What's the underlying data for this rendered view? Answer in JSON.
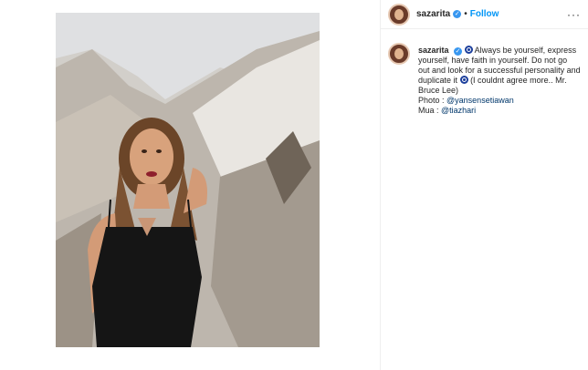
{
  "header": {
    "username": "sazarita",
    "separator": "•",
    "follow_label": "Follow",
    "more_label": "···"
  },
  "caption": {
    "username": "sazarita",
    "text_1": "Always be yourself, express yourself, have faith in yourself. Do not go out and look for a successful personality and duplicate it",
    "text_2": "(I couldnt agree more.. Mr. Bruce Lee)",
    "photo_label": "Photo : ",
    "photo_credit": "@yansensetiawan",
    "mua_label": "Mua : ",
    "mua_credit": "@tiazhari"
  },
  "colors": {
    "follow": "#0095f6",
    "verified_badge": "#3897f0",
    "mention": "#00376b"
  },
  "icons": {
    "verified": "verified-badge-icon",
    "nazar": "nazar-eye-icon"
  }
}
